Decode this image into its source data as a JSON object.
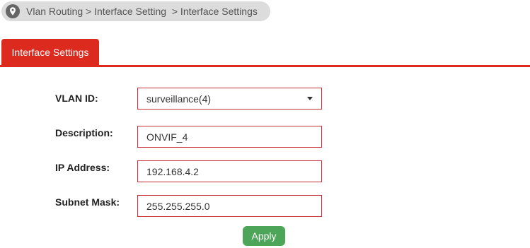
{
  "breadcrumb": {
    "icon": "map-pin-icon",
    "parts": [
      "Vlan Routing",
      " > Interface Setting",
      "  > Interface Settings"
    ]
  },
  "tabs": [
    {
      "label": "Interface Settings",
      "active": true
    }
  ],
  "form": {
    "vlan_id": {
      "label": "VLAN ID:",
      "value": "surveillance(4)"
    },
    "description": {
      "label": "Description:",
      "value": "ONVIF_4"
    },
    "ip_address": {
      "label": "IP Address:",
      "value": "192.168.4.2"
    },
    "subnet_mask": {
      "label": "Subnet Mask:",
      "value": "255.255.255.0"
    }
  },
  "actions": {
    "apply_label": "Apply"
  },
  "colors": {
    "accent": "#dd2a1f",
    "apply": "#4da55a",
    "field_border": "#c8323b",
    "breadcrumb_bg": "#dcdcdc"
  }
}
